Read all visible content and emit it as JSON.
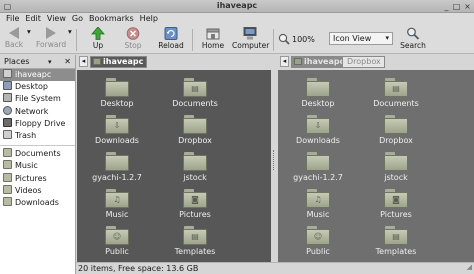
{
  "window": {
    "title": "ihaveapc"
  },
  "menu": [
    "File",
    "Edit",
    "View",
    "Go",
    "Bookmarks",
    "Help"
  ],
  "toolbar": {
    "back": "Back",
    "forward": "Forward",
    "up": "Up",
    "stop": "Stop",
    "reload": "Reload",
    "home": "Home",
    "computer": "Computer",
    "zoom": "100%",
    "view_mode": "Icon View",
    "search": "Search"
  },
  "sidebar": {
    "header": "Places",
    "places": [
      {
        "label": "ihaveapc",
        "icon": "home-icon",
        "selected": true
      },
      {
        "label": "Desktop",
        "icon": "desktop-icon"
      },
      {
        "label": "File System",
        "icon": "drive-icon"
      },
      {
        "label": "Network",
        "icon": "network-icon"
      },
      {
        "label": "Floppy Drive",
        "icon": "floppy-icon"
      },
      {
        "label": "Trash",
        "icon": "trash-icon"
      }
    ],
    "bookmarks": [
      {
        "label": "Documents",
        "icon": "folder-icon"
      },
      {
        "label": "Music",
        "icon": "folder-icon"
      },
      {
        "label": "Pictures",
        "icon": "folder-icon"
      },
      {
        "label": "Videos",
        "icon": "folder-icon"
      },
      {
        "label": "Downloads",
        "icon": "folder-icon"
      }
    ]
  },
  "left_pane": {
    "path": [
      "ihaveapc"
    ],
    "files": [
      {
        "name": "Desktop",
        "emblem": ""
      },
      {
        "name": "Documents",
        "emblem": "▤"
      },
      {
        "name": "Downloads",
        "emblem": "⇩"
      },
      {
        "name": "Dropbox",
        "emblem": ""
      },
      {
        "name": "gyachi-1.2.7",
        "emblem": ""
      },
      {
        "name": "jstock",
        "emblem": ""
      },
      {
        "name": "Music",
        "emblem": "♫"
      },
      {
        "name": "Pictures",
        "emblem": "◙"
      },
      {
        "name": "Public",
        "emblem": "☺"
      },
      {
        "name": "Templates",
        "emblem": "▤"
      }
    ]
  },
  "right_pane": {
    "path": [
      "ihaveapc",
      "Dropbox"
    ],
    "files": [
      {
        "name": "Desktop",
        "emblem": ""
      },
      {
        "name": "Documents",
        "emblem": "▤"
      },
      {
        "name": "Downloads",
        "emblem": "⇩"
      },
      {
        "name": "Dropbox",
        "emblem": ""
      },
      {
        "name": "gyachi-1.2.7",
        "emblem": ""
      },
      {
        "name": "jstock",
        "emblem": ""
      },
      {
        "name": "Music",
        "emblem": "♫"
      },
      {
        "name": "Pictures",
        "emblem": "◙"
      },
      {
        "name": "Public",
        "emblem": "☺"
      },
      {
        "name": "Templates",
        "emblem": "▤"
      }
    ]
  },
  "status": "20 items, Free space: 13.6 GB",
  "colors": {
    "active_pane": "#575757",
    "inactive_pane": "#6f6f6f",
    "folder": "#b8bca6",
    "selection": "#8d8d8d"
  }
}
